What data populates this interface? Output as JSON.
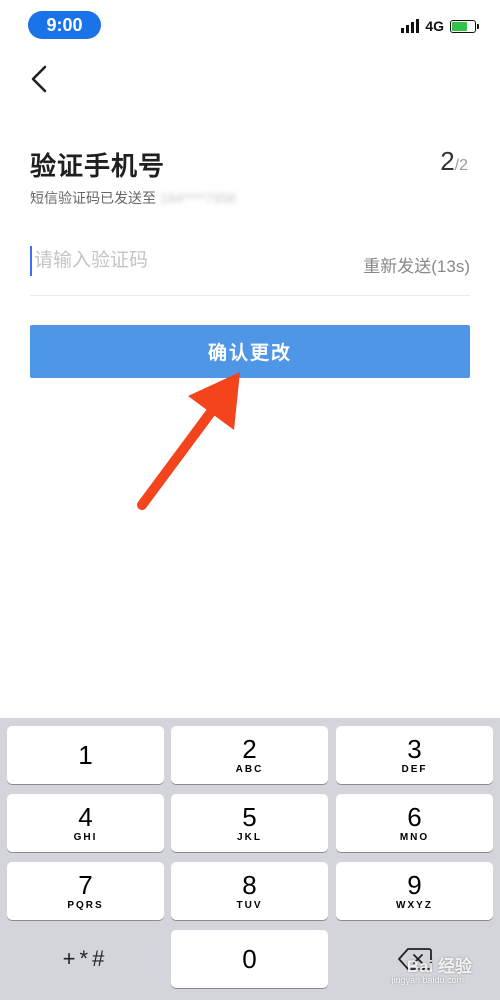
{
  "status_bar": {
    "time": "9:00",
    "network": "4G",
    "battery_level": 0.7,
    "battery_color": "#35c24b",
    "accent": "#1a73e8"
  },
  "nav": {
    "back_icon": "chevron-left-icon"
  },
  "header": {
    "title": "验证手机号",
    "step_current": "2",
    "step_total": "/2",
    "subtitle": "短信验证码已发送至",
    "phone_masked": "184****7956"
  },
  "form": {
    "code_placeholder": "请输入验证码",
    "code_value": "",
    "resend_label": "重新发送(13s)",
    "confirm_label": "确认更改",
    "confirm_color": "#4f96e6"
  },
  "annotation": {
    "arrow_color": "#f3441e"
  },
  "keyboard": {
    "keys": [
      {
        "digit": "1",
        "letters": ""
      },
      {
        "digit": "2",
        "letters": "ABC"
      },
      {
        "digit": "3",
        "letters": "DEF"
      },
      {
        "digit": "4",
        "letters": "GHI"
      },
      {
        "digit": "5",
        "letters": "JKL"
      },
      {
        "digit": "6",
        "letters": "MNO"
      },
      {
        "digit": "7",
        "letters": "PQRS"
      },
      {
        "digit": "8",
        "letters": "TUV"
      },
      {
        "digit": "9",
        "letters": "WXYZ"
      }
    ],
    "symbols": "+*#",
    "zero": "0",
    "delete_icon": "backspace-icon"
  },
  "watermark": {
    "brand": "Bai 经验",
    "url": "jingyan.baidu.com"
  }
}
